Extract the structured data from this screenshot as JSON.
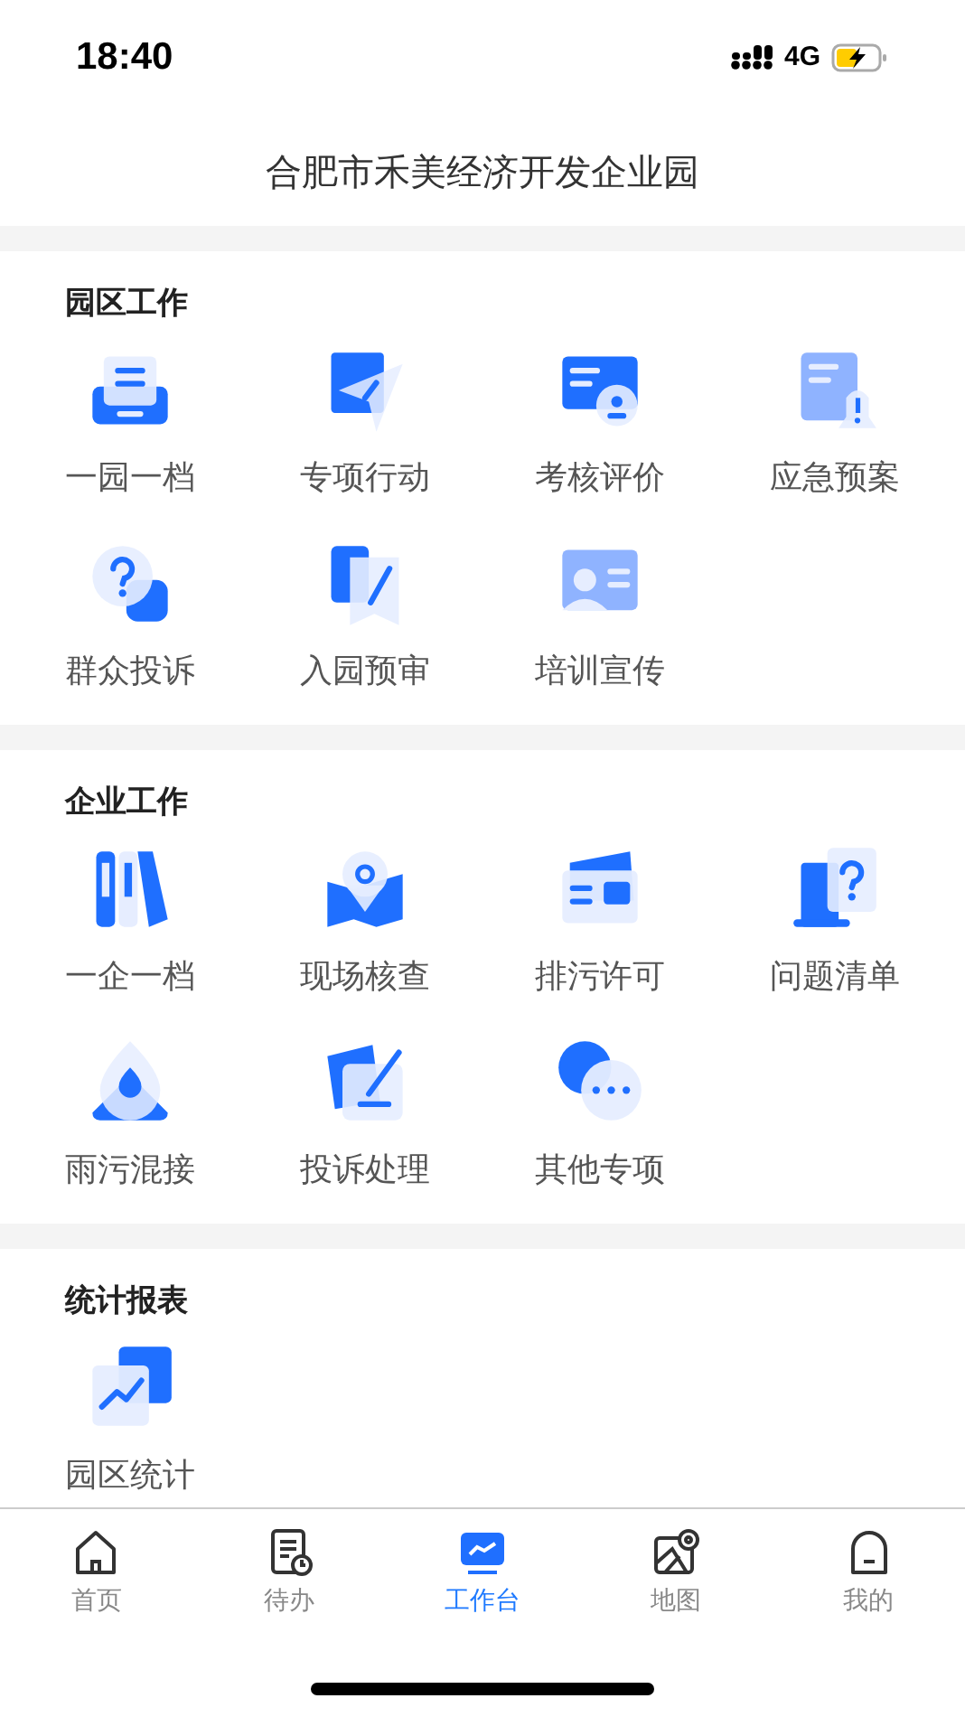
{
  "status_bar": {
    "time": "18:40",
    "network": "4G"
  },
  "title": "合肥市禾美经济开发企业园",
  "sections": [
    {
      "title": "园区工作",
      "items": [
        {
          "label": "一园一档"
        },
        {
          "label": "专项行动"
        },
        {
          "label": "考核评价"
        },
        {
          "label": "应急预案"
        },
        {
          "label": "群众投诉"
        },
        {
          "label": "入园预审"
        },
        {
          "label": "培训宣传"
        }
      ]
    },
    {
      "title": "企业工作",
      "items": [
        {
          "label": "一企一档"
        },
        {
          "label": "现场核查"
        },
        {
          "label": "排污许可"
        },
        {
          "label": "问题清单"
        },
        {
          "label": "雨污混接"
        },
        {
          "label": "投诉处理"
        },
        {
          "label": "其他专项"
        }
      ]
    },
    {
      "title": "统计报表",
      "items": [
        {
          "label": "园区统计"
        }
      ]
    }
  ],
  "tabs": [
    {
      "label": "首页",
      "selected": false
    },
    {
      "label": "待办",
      "selected": false
    },
    {
      "label": "工作台",
      "selected": true
    },
    {
      "label": "地图",
      "selected": false
    },
    {
      "label": "我的",
      "selected": false
    }
  ]
}
